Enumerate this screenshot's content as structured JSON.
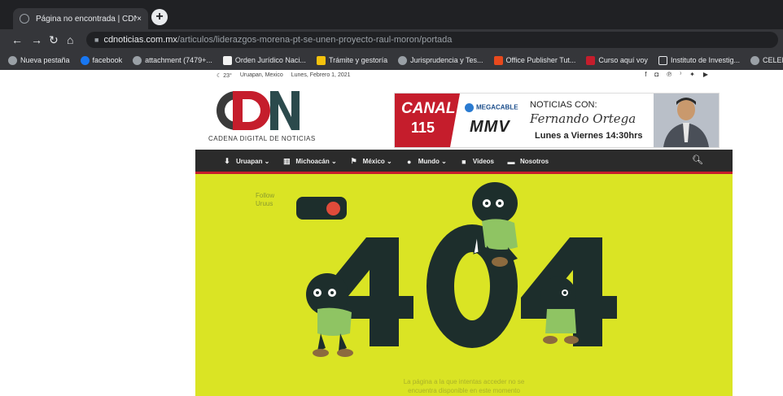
{
  "browser": {
    "tab_title": "Página no encontrada | CDN",
    "tab_close": "×",
    "new_tab": "+",
    "url_host": "cdnoticias.com.mx",
    "url_path": "/articulos/liderazgos-morena-pt-se-unen-proyecto-raul-moron/portada",
    "bookmarks": [
      {
        "label": "Nueva pestaña",
        "color": "#9aa0a6"
      },
      {
        "label": "facebook",
        "color": "#1877f2"
      },
      {
        "label": "attachment (7479+...",
        "color": "#9aa0a6"
      },
      {
        "label": "Orden Jurídico Naci...",
        "color": "#f2f2f2"
      },
      {
        "label": "Trámite y gestoría",
        "color": "#f4c20d"
      },
      {
        "label": "Jurisprudencia y Tes...",
        "color": "#9aa0a6"
      },
      {
        "label": "Office Publisher Tut...",
        "color": "#e8491d"
      },
      {
        "label": "Curso aquí voy",
        "color": "#c51d2c"
      },
      {
        "label": "Instituto de Investig...",
        "color": "#e8eaed"
      },
      {
        "label": "CELEM",
        "color": "#9aa0a6"
      }
    ]
  },
  "site": {
    "weather": "23°",
    "city": "Uruapan, Mexico",
    "date": "Lunes, Febrero 1, 2021",
    "logo_text": "CDN",
    "logo_sub": "CADENA DIGITAL DE NOTICIAS",
    "banner": {
      "canal": "CANAL",
      "number": "115",
      "mega": "MEGACABLE",
      "mmv": "MMV",
      "noticias": "NOTICIAS CON:",
      "host": "Fernando Ortega",
      "hours": "Lunes a Viernes 14:30hrs"
    },
    "nav": [
      {
        "label": "Uruapan",
        "icon": "pin-icon"
      },
      {
        "label": "Michoacán",
        "icon": "building-icon"
      },
      {
        "label": "México",
        "icon": "flag-icon"
      },
      {
        "label": "Mundo",
        "icon": "globe-icon"
      },
      {
        "label": "Videos",
        "icon": "video-icon"
      },
      {
        "label": "Nosotros",
        "icon": "monitor-icon"
      }
    ],
    "hero": {
      "flag_line1": "Follow",
      "flag_line2": "Uruus",
      "code": "404",
      "message_line1": "La página a la que intentas acceder no se",
      "message_line2": "encuentra disponible en este momento"
    }
  },
  "colors": {
    "brand_red": "#c51d2c",
    "hero_yellow": "#dae424",
    "digit": "#1d2e2c"
  }
}
